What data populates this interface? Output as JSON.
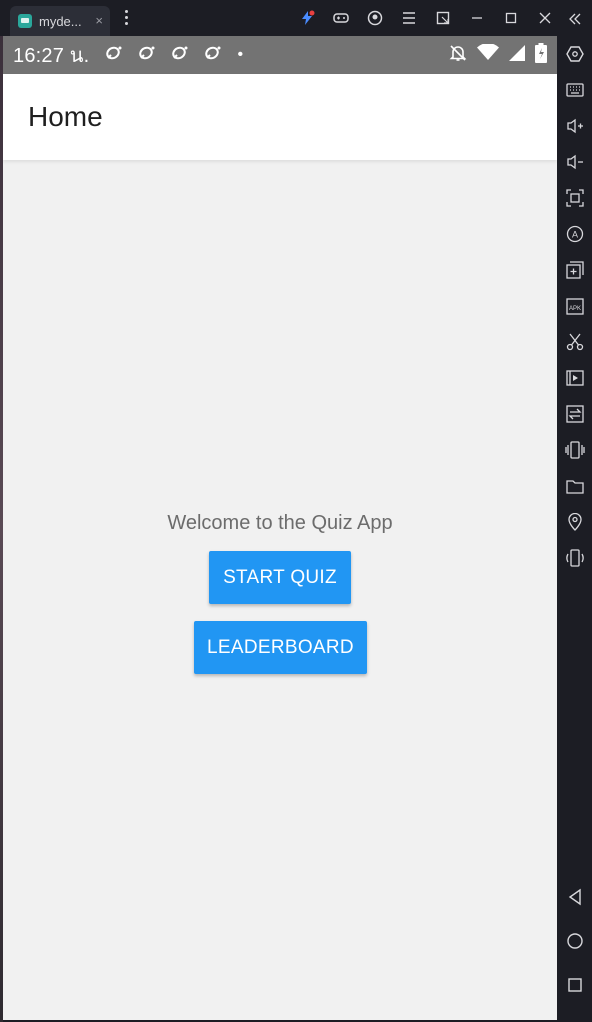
{
  "emulator": {
    "tab_title": "myde...",
    "tab_close": "×",
    "toolbar_icons": [
      "bolt-icon",
      "gamepad-icon",
      "account-icon",
      "menu-icon",
      "expand-window-icon",
      "minimize-icon",
      "maximize-icon",
      "close-icon"
    ],
    "sidebar_icons": [
      "collapse-icon",
      "settings-hex-icon",
      "keyboard-icon",
      "volume-up-icon",
      "volume-down-icon",
      "screenshot-icon",
      "translate-icon",
      "add-window-icon",
      "apk-icon",
      "scissors-icon",
      "record-icon",
      "transfer-icon",
      "shake-icon",
      "folder-icon",
      "location-icon",
      "rotate-icon",
      "back-icon",
      "home-icon",
      "recents-icon"
    ]
  },
  "status_bar": {
    "time": "16:27 น.",
    "dot": "•"
  },
  "app_bar": {
    "title": "Home"
  },
  "main": {
    "welcome_text": "Welcome to the Quiz App",
    "start_quiz_label": "START QUIZ",
    "leaderboard_label": "LEADERBOARD"
  },
  "colors": {
    "primary": "#2196f3",
    "status_bar": "#737373",
    "background": "#f1f1f1"
  }
}
